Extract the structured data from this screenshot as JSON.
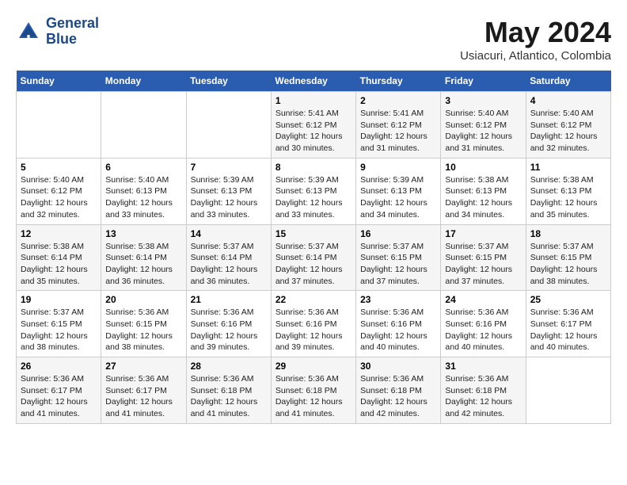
{
  "header": {
    "logo_line1": "General",
    "logo_line2": "Blue",
    "month": "May 2024",
    "location": "Usiacuri, Atlantico, Colombia"
  },
  "days_of_week": [
    "Sunday",
    "Monday",
    "Tuesday",
    "Wednesday",
    "Thursday",
    "Friday",
    "Saturday"
  ],
  "weeks": [
    [
      {
        "day": "",
        "content": ""
      },
      {
        "day": "",
        "content": ""
      },
      {
        "day": "",
        "content": ""
      },
      {
        "day": "1",
        "content": "Sunrise: 5:41 AM\nSunset: 6:12 PM\nDaylight: 12 hours\nand 30 minutes."
      },
      {
        "day": "2",
        "content": "Sunrise: 5:41 AM\nSunset: 6:12 PM\nDaylight: 12 hours\nand 31 minutes."
      },
      {
        "day": "3",
        "content": "Sunrise: 5:40 AM\nSunset: 6:12 PM\nDaylight: 12 hours\nand 31 minutes."
      },
      {
        "day": "4",
        "content": "Sunrise: 5:40 AM\nSunset: 6:12 PM\nDaylight: 12 hours\nand 32 minutes."
      }
    ],
    [
      {
        "day": "5",
        "content": "Sunrise: 5:40 AM\nSunset: 6:12 PM\nDaylight: 12 hours\nand 32 minutes."
      },
      {
        "day": "6",
        "content": "Sunrise: 5:40 AM\nSunset: 6:13 PM\nDaylight: 12 hours\nand 33 minutes."
      },
      {
        "day": "7",
        "content": "Sunrise: 5:39 AM\nSunset: 6:13 PM\nDaylight: 12 hours\nand 33 minutes."
      },
      {
        "day": "8",
        "content": "Sunrise: 5:39 AM\nSunset: 6:13 PM\nDaylight: 12 hours\nand 33 minutes."
      },
      {
        "day": "9",
        "content": "Sunrise: 5:39 AM\nSunset: 6:13 PM\nDaylight: 12 hours\nand 34 minutes."
      },
      {
        "day": "10",
        "content": "Sunrise: 5:38 AM\nSunset: 6:13 PM\nDaylight: 12 hours\nand 34 minutes."
      },
      {
        "day": "11",
        "content": "Sunrise: 5:38 AM\nSunset: 6:13 PM\nDaylight: 12 hours\nand 35 minutes."
      }
    ],
    [
      {
        "day": "12",
        "content": "Sunrise: 5:38 AM\nSunset: 6:14 PM\nDaylight: 12 hours\nand 35 minutes."
      },
      {
        "day": "13",
        "content": "Sunrise: 5:38 AM\nSunset: 6:14 PM\nDaylight: 12 hours\nand 36 minutes."
      },
      {
        "day": "14",
        "content": "Sunrise: 5:37 AM\nSunset: 6:14 PM\nDaylight: 12 hours\nand 36 minutes."
      },
      {
        "day": "15",
        "content": "Sunrise: 5:37 AM\nSunset: 6:14 PM\nDaylight: 12 hours\nand 37 minutes."
      },
      {
        "day": "16",
        "content": "Sunrise: 5:37 AM\nSunset: 6:15 PM\nDaylight: 12 hours\nand 37 minutes."
      },
      {
        "day": "17",
        "content": "Sunrise: 5:37 AM\nSunset: 6:15 PM\nDaylight: 12 hours\nand 37 minutes."
      },
      {
        "day": "18",
        "content": "Sunrise: 5:37 AM\nSunset: 6:15 PM\nDaylight: 12 hours\nand 38 minutes."
      }
    ],
    [
      {
        "day": "19",
        "content": "Sunrise: 5:37 AM\nSunset: 6:15 PM\nDaylight: 12 hours\nand 38 minutes."
      },
      {
        "day": "20",
        "content": "Sunrise: 5:36 AM\nSunset: 6:15 PM\nDaylight: 12 hours\nand 38 minutes."
      },
      {
        "day": "21",
        "content": "Sunrise: 5:36 AM\nSunset: 6:16 PM\nDaylight: 12 hours\nand 39 minutes."
      },
      {
        "day": "22",
        "content": "Sunrise: 5:36 AM\nSunset: 6:16 PM\nDaylight: 12 hours\nand 39 minutes."
      },
      {
        "day": "23",
        "content": "Sunrise: 5:36 AM\nSunset: 6:16 PM\nDaylight: 12 hours\nand 40 minutes."
      },
      {
        "day": "24",
        "content": "Sunrise: 5:36 AM\nSunset: 6:16 PM\nDaylight: 12 hours\nand 40 minutes."
      },
      {
        "day": "25",
        "content": "Sunrise: 5:36 AM\nSunset: 6:17 PM\nDaylight: 12 hours\nand 40 minutes."
      }
    ],
    [
      {
        "day": "26",
        "content": "Sunrise: 5:36 AM\nSunset: 6:17 PM\nDaylight: 12 hours\nand 41 minutes."
      },
      {
        "day": "27",
        "content": "Sunrise: 5:36 AM\nSunset: 6:17 PM\nDaylight: 12 hours\nand 41 minutes."
      },
      {
        "day": "28",
        "content": "Sunrise: 5:36 AM\nSunset: 6:18 PM\nDaylight: 12 hours\nand 41 minutes."
      },
      {
        "day": "29",
        "content": "Sunrise: 5:36 AM\nSunset: 6:18 PM\nDaylight: 12 hours\nand 41 minutes."
      },
      {
        "day": "30",
        "content": "Sunrise: 5:36 AM\nSunset: 6:18 PM\nDaylight: 12 hours\nand 42 minutes."
      },
      {
        "day": "31",
        "content": "Sunrise: 5:36 AM\nSunset: 6:18 PM\nDaylight: 12 hours\nand 42 minutes."
      },
      {
        "day": "",
        "content": ""
      }
    ]
  ]
}
